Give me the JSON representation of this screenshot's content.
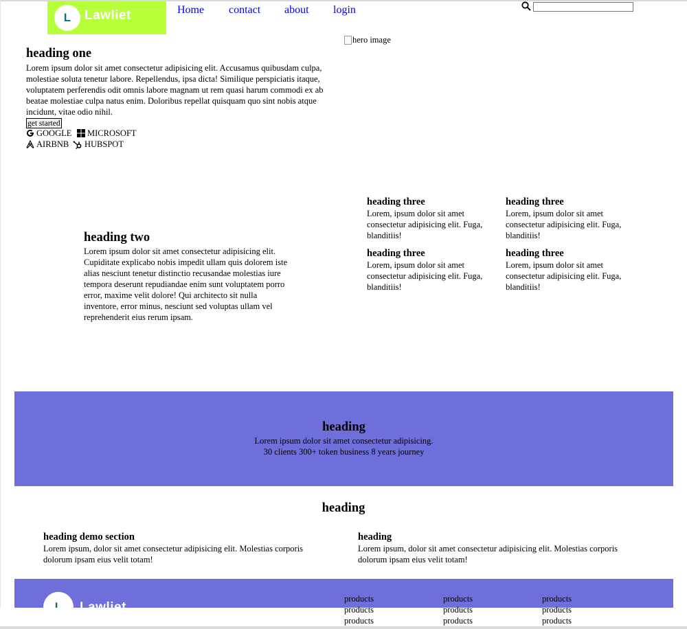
{
  "nav": {
    "logo_letter": "L",
    "logo_text": "Lawliet",
    "links": [
      "Home",
      "contact",
      "about",
      "login"
    ],
    "search_value": ""
  },
  "hero": {
    "heading": "heading one",
    "text": "Lorem ipsum dolor sit amet consectetur adipisicing elit. Accusamus quibusdam culpa, molestiae soluta tenetur labore. Repellendus, ipsa dicta! Similique perspiciatis itaque, voluptatem perferendis odit omnis labore magnam ut rem quasi harum commodi ex ab beatae molestiae culpa natus enim. Doloribus repellat quisquam quo sint nobis atque incidunt, vitae odio nihil.",
    "button": "get started",
    "brands": [
      "GOOGLE",
      "MICROSOFT",
      "AIRBNB",
      "HUBSPOT"
    ],
    "image_alt": "hero image"
  },
  "section2": {
    "heading": "heading two",
    "text": "Lorem ipsum dolor sit amet consectetur adipisicing elit. Cupiditate explicabo nobis impedit ullam quis dolorem iste alias nesciunt tenetur distinctio recusandae molestias iure tempora deserunt repudiandae enim sunt voluptatem porro error, maxime velit dolore! Qui architecto sit nulla inventore, error minus, nesciunt sed voluptas ullam vel reprehenderit eius rerum ipsam.",
    "features": [
      {
        "title": "heading three",
        "text": "Lorem, ipsum dolor sit amet consectetur adipisicing elit. Fuga, blanditiis!"
      },
      {
        "title": "heading three",
        "text": "Lorem, ipsum dolor sit amet consectetur adipisicing elit. Fuga, blanditiis!"
      },
      {
        "title": "heading three",
        "text": "Lorem, ipsum dolor sit amet consectetur adipisicing elit. Fuga, blanditiis!"
      },
      {
        "title": "heading three",
        "text": "Lorem, ipsum dolor sit amet consectetur adipisicing elit. Fuga, blanditiis!"
      }
    ]
  },
  "banner": {
    "heading": "heading",
    "line1": "Lorem ipsum dolor sit amet consectetur adipisicing.",
    "line2": "30 clients 300+ token business 8 years journey",
    "color": "#6f6fdc"
  },
  "section4": {
    "heading": "heading",
    "columns": [
      {
        "title": "heading demo section",
        "text": "Lorem ipsum, dolor sit amet consectetur adipisicing elit. Molestias corporis dolorum ipsam eius velit totam!"
      },
      {
        "title": "heading",
        "text": "Lorem ipsum, dolor sit amet consectetur adipisicing elit. Molestias corporis dolorum ipsam eius velit totam!"
      }
    ]
  },
  "footer": {
    "logo_letter": "L",
    "logo_text": "Lawliet",
    "columns": [
      [
        "products",
        "products",
        "products"
      ],
      [
        "products",
        "products",
        "products"
      ],
      [
        "products",
        "products",
        "products"
      ]
    ]
  },
  "colors": {
    "logo_bg": "#b7ff38",
    "accent": "#6f6fdc",
    "link": "#0000ee"
  }
}
